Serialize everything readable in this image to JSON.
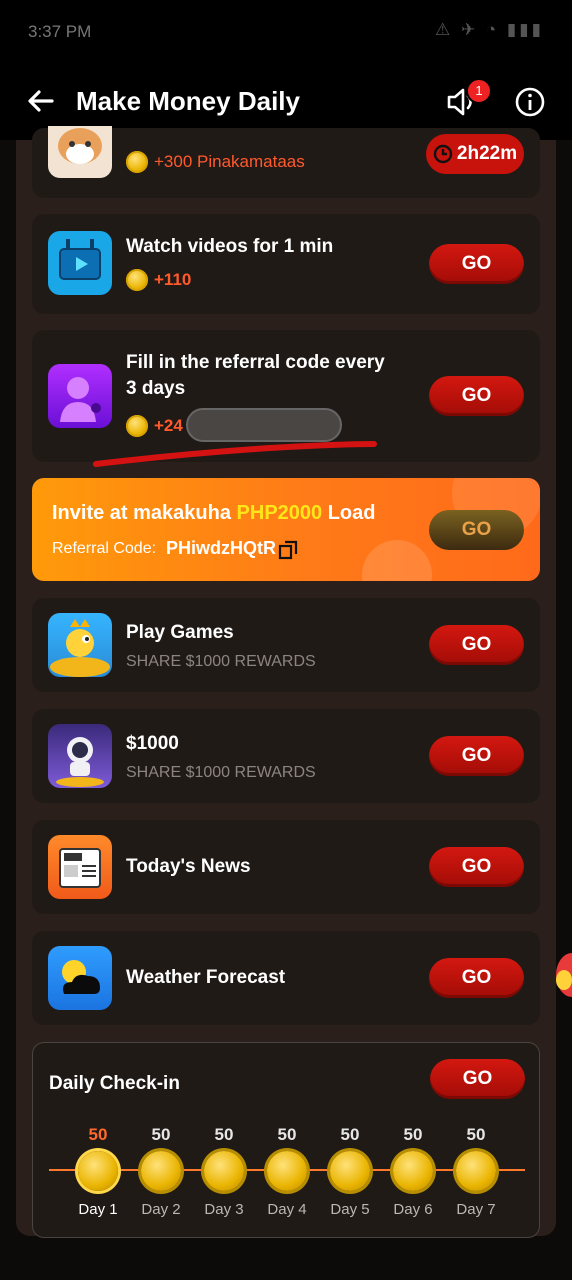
{
  "status_bar": {
    "time": "3:37 PM",
    "indicators": "⚠ ✈ ◔ ▮▮▮"
  },
  "header": {
    "title": "Make Money Daily",
    "notification_count": "1"
  },
  "tasks": [
    {
      "id": "cat-task",
      "reward": "+300 Pinakamataas",
      "timer": "2h22m"
    },
    {
      "id": "watch-videos",
      "title": "Watch videos for 1 min",
      "reward": "+110",
      "button": "GO"
    },
    {
      "id": "referral-code",
      "title": "Fill in the referral code every 3 days",
      "reward": "+24",
      "button": "GO"
    }
  ],
  "invite": {
    "title_prefix": "Invite at makakuha ",
    "title_highlight": "PHP2000",
    "title_suffix": " Load",
    "referral_label": "Referral Code: ",
    "referral_code": "PHiwdzHQtR",
    "button": "GO"
  },
  "apps": [
    {
      "id": "play-games",
      "title": "Play Games",
      "subtitle": "SHARE $1000 REWARDS",
      "button": "GO"
    },
    {
      "id": "dollar-1000",
      "title": "$1000",
      "subtitle": "SHARE $1000 REWARDS",
      "button": "GO"
    },
    {
      "id": "todays-news",
      "title": "Today's News",
      "button": "GO"
    },
    {
      "id": "weather",
      "title": "Weather Forecast",
      "button": "GO"
    }
  ],
  "checkin": {
    "title": "Daily Check-in",
    "button": "GO",
    "days": [
      {
        "points": "50",
        "label": "Day 1",
        "active": true
      },
      {
        "points": "50",
        "label": "Day 2",
        "active": false
      },
      {
        "points": "50",
        "label": "Day 3",
        "active": false
      },
      {
        "points": "50",
        "label": "Day 4",
        "active": false
      },
      {
        "points": "50",
        "label": "Day 5",
        "active": false
      },
      {
        "points": "50",
        "label": "Day 6",
        "active": false
      },
      {
        "points": "50",
        "label": "Day 7",
        "active": false
      }
    ]
  },
  "colors": {
    "accent_red": "#c8120c",
    "reward_orange": "#ff5a2c",
    "invite_orange": "#ff8a12",
    "highlight_yellow": "#ffe619"
  }
}
